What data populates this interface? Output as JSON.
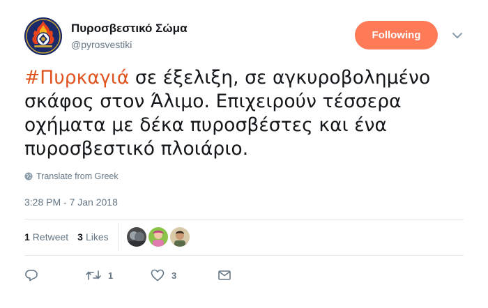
{
  "author": {
    "display_name": "Πυροσβεστικό Σώμα",
    "handle": "@pyrosvestiki",
    "avatar_icon": "fire-service-emblem-icon"
  },
  "follow_button": {
    "label": "Following",
    "color": "#ff7b57"
  },
  "tweet": {
    "hashtag": "#Πυρκαγιά",
    "text_after_hashtag": " σε έξελιξη, σε αγκυροβολημένο σκάφος στον Άλιμο. Επιχειρούν  τέσσερα οχήματα με δέκα πυροσβέστες και ένα πυροσβεστικό πλοιάριο.",
    "hashtag_color": "#e0531f"
  },
  "translate": {
    "label": "Translate from Greek",
    "icon": "globe-icon"
  },
  "timestamp": "3:28 PM - 7 Jan 2018",
  "stats": {
    "retweets_count": "1",
    "retweets_label": "Retweet",
    "likes_count": "3",
    "likes_label": "Likes"
  },
  "actions": {
    "reply_icon": "reply-icon",
    "retweet_icon": "retweet-icon",
    "retweet_count": "1",
    "like_icon": "heart-icon",
    "like_count": "3",
    "message_icon": "envelope-icon"
  }
}
